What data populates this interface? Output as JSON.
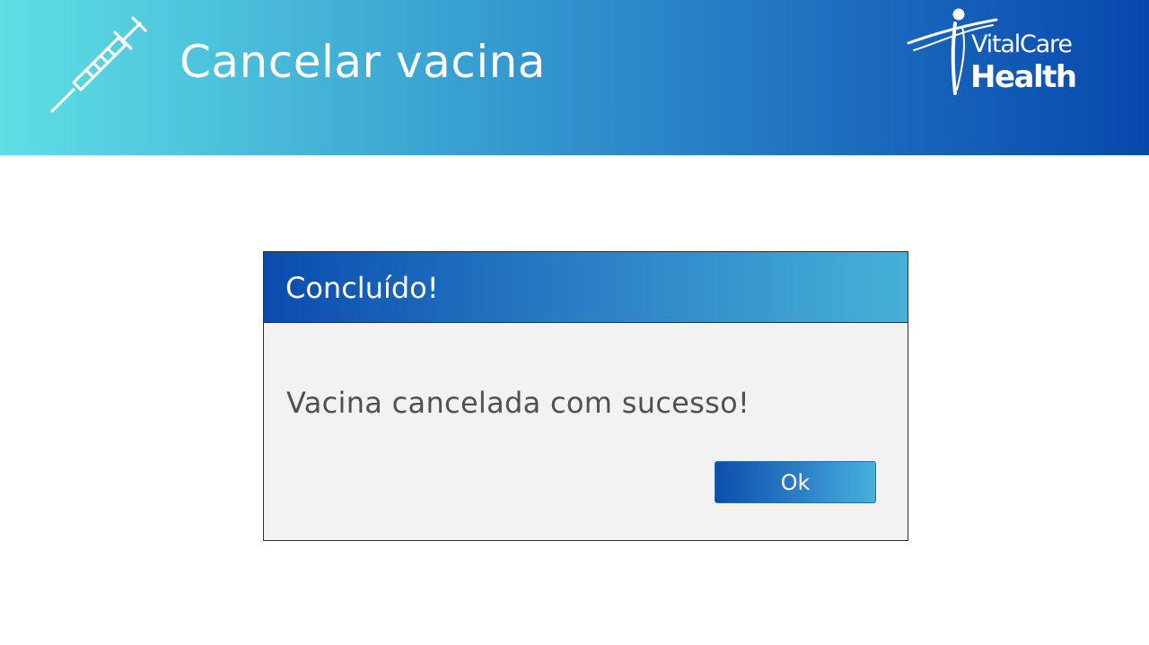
{
  "header": {
    "title": "Cancelar vacina",
    "icon": "syringe-icon",
    "gradient_colors": [
      "#5fdfe4",
      "#3aa3d2",
      "#1f6fc0",
      "#0748ad"
    ]
  },
  "logo": {
    "line1": "VitalCare",
    "line2": "Health",
    "icon": "person-swoosh-logo-icon"
  },
  "dialog": {
    "title": "Concluído!",
    "message": "Vacina cancelada com sucesso!",
    "ok_label": "Ok",
    "header_gradient": [
      "#0a4cae",
      "#2b7fc5",
      "#46b0d8"
    ],
    "body_color": "#f2f2f2",
    "message_color": "#505050"
  }
}
